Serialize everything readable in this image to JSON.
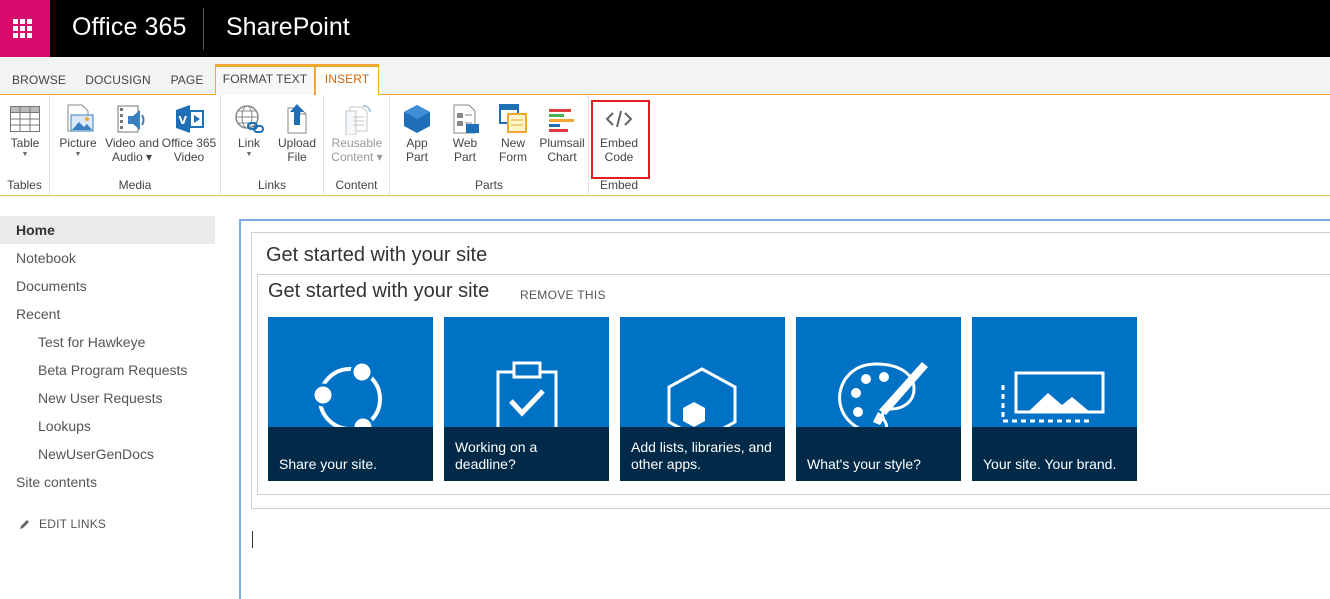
{
  "suite": {
    "brand": "Office 365",
    "app": "SharePoint",
    "waffle_color": "#d90a6c"
  },
  "tabs": [
    {
      "label": "BROWSE"
    },
    {
      "label": "DOCUSIGN"
    },
    {
      "label": "PAGE"
    },
    {
      "label": "FORMAT TEXT"
    },
    {
      "label": "INSERT"
    }
  ],
  "ribbon": {
    "groups": {
      "tables": "Tables",
      "media": "Media",
      "links": "Links",
      "content": "Content",
      "parts": "Parts",
      "embed": "Embed"
    },
    "buttons": {
      "table": {
        "line1": "Table",
        "line2": "",
        "icon": "table-icon"
      },
      "picture": {
        "line1": "Picture",
        "line2": "",
        "icon": "picture-icon"
      },
      "video_audio": {
        "line1": "Video and",
        "line2": "Audio",
        "icon": "video-audio-icon"
      },
      "office365_video": {
        "line1": "Office 365",
        "line2": "Video",
        "icon": "office365-video-icon"
      },
      "link": {
        "line1": "Link",
        "line2": "",
        "icon": "link-globe-icon"
      },
      "upload_file": {
        "line1": "Upload",
        "line2": "File",
        "icon": "upload-file-icon"
      },
      "reusable_content": {
        "line1": "Reusable",
        "line2": "Content",
        "icon": "reusable-content-icon"
      },
      "app_part": {
        "line1": "App",
        "line2": "Part",
        "icon": "app-part-icon"
      },
      "web_part": {
        "line1": "Web",
        "line2": "Part",
        "icon": "web-part-icon"
      },
      "new_form": {
        "line1": "New",
        "line2": "Form",
        "icon": "new-form-icon"
      },
      "plumsail_chart": {
        "line1": "Plumsail",
        "line2": "Chart",
        "icon": "plumsail-chart-icon"
      },
      "embed_code": {
        "line1": "Embed",
        "line2": "Code",
        "icon": "embed-code-icon"
      }
    }
  },
  "nav": {
    "items": [
      {
        "label": "Home"
      },
      {
        "label": "Notebook"
      },
      {
        "label": "Documents"
      },
      {
        "label": "Recent"
      },
      {
        "label": "Test for Hawkeye"
      },
      {
        "label": "Beta Program Requests"
      },
      {
        "label": "New User Requests"
      },
      {
        "label": "Lookups"
      },
      {
        "label": "NewUserGenDocs"
      },
      {
        "label": "Site contents"
      }
    ],
    "edit_links": "EDIT LINKS"
  },
  "content": {
    "webpart_title": "Get started with your site",
    "getstarted_title": "Get started with your site",
    "remove_link": "REMOVE THIS",
    "tiles": [
      {
        "caption": "Share your site.",
        "icon": "share-icon"
      },
      {
        "caption": "Working on a deadline?",
        "icon": "clipboard-check-icon"
      },
      {
        "caption": "Add lists, libraries, and other apps.",
        "icon": "apps-hexagon-icon"
      },
      {
        "caption": "What's your style?",
        "icon": "palette-brush-icon"
      },
      {
        "caption": "Your site. Your brand.",
        "icon": "brand-image-icon"
      }
    ],
    "tile_color": "#0072c6",
    "caption_color": "#002a47"
  }
}
